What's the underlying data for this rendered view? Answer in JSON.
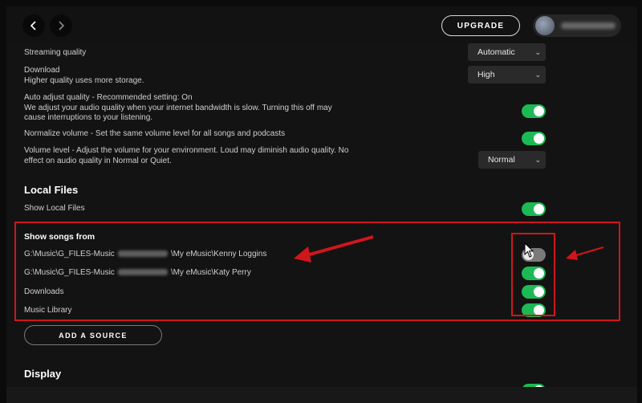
{
  "topbar": {
    "upgrade_label": "UPGRADE"
  },
  "playback": {
    "streaming_quality": {
      "label": "Streaming quality",
      "value": "Automatic"
    },
    "download": {
      "label": "Download",
      "sublabel": "Higher quality uses more storage.",
      "value": "High"
    },
    "auto_adjust": {
      "label": "Auto adjust quality - Recommended setting: On",
      "desc_line1": "We adjust your audio quality when your internet bandwidth is slow. Turning this off may",
      "desc_line2": "cause interruptions to your listening.",
      "on": true
    },
    "normalize": {
      "label": "Normalize volume - Set the same volume level for all songs and podcasts",
      "on": true
    },
    "volume_level": {
      "label_line1": "Volume level - Adjust the volume for your environment. Loud may diminish audio quality. No",
      "label_line2": "effect on audio quality in Normal or Quiet.",
      "value": "Normal"
    }
  },
  "local_files": {
    "heading": "Local Files",
    "show_local_files": {
      "label": "Show Local Files",
      "on": true
    },
    "show_songs_from": {
      "heading": "Show songs from",
      "sources": [
        {
          "path_start": "G:\\Music\\G_FILES-Music",
          "path_end": "\\My eMusic\\Kenny Loggins",
          "on": false
        },
        {
          "path_start": "G:\\Music\\G_FILES-Music",
          "path_end": "\\My eMusic\\Katy Perry",
          "on": true
        },
        {
          "path_start": "Downloads",
          "path_end": "",
          "on": true
        },
        {
          "path_start": "Music Library",
          "path_end": "",
          "on": true
        }
      ]
    },
    "add_source_label": "ADD A SOURCE"
  },
  "display": {
    "heading": "Display"
  },
  "colors": {
    "accent_green": "#1db954",
    "highlight_red": "#d0161b",
    "background": "#131313"
  },
  "icons": [
    "chevron-left-icon",
    "chevron-right-icon",
    "chevron-down-icon",
    "arrow-annotation-icon",
    "cursor-icon"
  ]
}
